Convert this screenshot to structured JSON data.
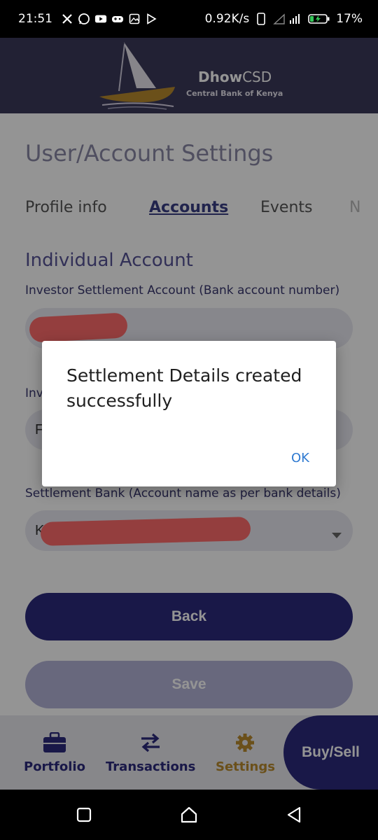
{
  "status_bar": {
    "time": "21:51",
    "network_speed": "0.92K/s",
    "battery": "17%",
    "icons": [
      "x-icon",
      "whatsapp-icon",
      "youtube-icon",
      "gamepad-icon",
      "gallery-icon",
      "play-store-icon",
      "phone-outline-icon",
      "signal-icon",
      "battery-charging-icon"
    ]
  },
  "header": {
    "brand_bold": "Dhow",
    "brand_regular": "CSD",
    "subtitle": "Central Bank of Kenya"
  },
  "page": {
    "title": "User/Account Settings",
    "tabs": [
      {
        "label": "Profile info",
        "active": false
      },
      {
        "label": "Accounts",
        "active": true
      },
      {
        "label": "Events",
        "active": false
      },
      {
        "label": "N",
        "active": false
      }
    ],
    "section_title": "Individual Account",
    "field1_label": "Investor Settlement Account (Bank account number)",
    "field1_value": "",
    "field2_label": "Inv",
    "field2_value": "F",
    "field3_label": "Settlement Bank (Account name as per bank details)",
    "field3_value": "K",
    "back_label": "Back",
    "save_label": "Save"
  },
  "bottom_nav": {
    "items": [
      {
        "label": "Portfolio",
        "icon": "briefcase-icon"
      },
      {
        "label": "Transactions",
        "icon": "transfer-arrows-icon"
      },
      {
        "label": "Settings",
        "icon": "gear-icon"
      }
    ],
    "buy_sell": "Buy/Sell"
  },
  "dialog": {
    "message": "Settlement Details created successfully",
    "ok_label": "OK"
  },
  "colors": {
    "primary": "#2c2a7c",
    "header": "#3c3a5a",
    "accent_gold": "#b88a2e",
    "dialog_button": "#2f7ad1"
  }
}
